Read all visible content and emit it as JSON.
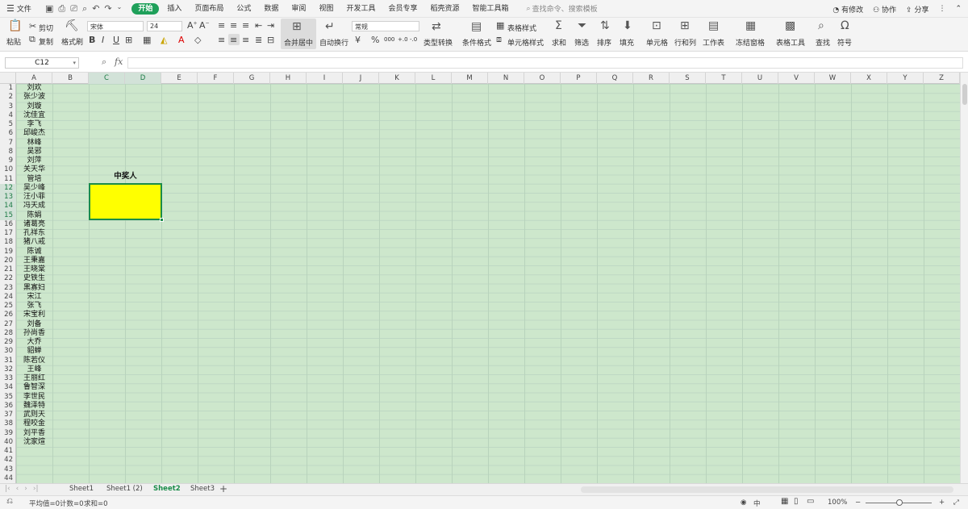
{
  "menubar": {
    "file_label": "文件",
    "tabs": [
      "开始",
      "插入",
      "页面布局",
      "公式",
      "数据",
      "审阅",
      "视图",
      "开发工具",
      "会员专享",
      "稻壳资源",
      "智能工具箱"
    ],
    "active_tab": "开始",
    "search_placeholder": "查找命令、搜索模板",
    "changes_label": "有修改",
    "collab_label": "协作",
    "share_label": "分享"
  },
  "ribbon": {
    "paste": "粘贴",
    "cut": "剪切",
    "copy": "复制",
    "format_painter": "格式刷",
    "font_name": "宋体",
    "font_size": "24",
    "merge_center": "合并居中",
    "wrap_text": "自动换行",
    "number_format": "常规",
    "type_convert": "类型转换",
    "cond_format": "条件格式",
    "table_style": "表格样式",
    "cell_style": "单元格样式",
    "sum": "求和",
    "filter": "筛选",
    "sort": "排序",
    "fill": "填充",
    "cell": "单元格",
    "row_col": "行和列",
    "worksheet": "工作表",
    "freeze": "冻结窗格",
    "table_tools": "表格工具",
    "find": "查找",
    "symbol": "符号"
  },
  "formula_bar": {
    "name_box": "C12",
    "fx": "fx",
    "content": ""
  },
  "columns": [
    "A",
    "B",
    "C",
    "D",
    "E",
    "F",
    "G",
    "H",
    "I",
    "J",
    "K",
    "L",
    "M",
    "N",
    "O",
    "P",
    "Q",
    "R",
    "S",
    "T",
    "U",
    "V",
    "W",
    "X",
    "Y",
    "Z"
  ],
  "selected_columns": [
    "C",
    "D"
  ],
  "rows": [
    "1",
    "2",
    "3",
    "4",
    "5",
    "6",
    "7",
    "8",
    "9",
    "10",
    "11",
    "12",
    "13",
    "14",
    "15",
    "16",
    "17",
    "18",
    "19",
    "20",
    "21",
    "22",
    "23",
    "24",
    "25",
    "26",
    "27",
    "28",
    "29",
    "30",
    "31",
    "32",
    "33",
    "34",
    "35",
    "36",
    "37",
    "38",
    "39",
    "40",
    "41",
    "42",
    "43",
    "44"
  ],
  "selected_rows": [
    "12",
    "13",
    "14",
    "15"
  ],
  "names": [
    "刘欢",
    "张少波",
    "刘璇",
    "沈佳宜",
    "李飞",
    "邱峻杰",
    "林峰",
    "吴邪",
    "刘萍",
    "关天华",
    "管培",
    "吴少峰",
    "汪小菲",
    "冯天成",
    "陈娟",
    "诸葛亮",
    "孔祥东",
    "猪八戒",
    "陈诚",
    "王秉嘉",
    "王晓棠",
    "史铁生",
    "黑寡妇",
    "宋江",
    "张飞",
    "宋宝利",
    "刘备",
    "孙尚香",
    "大乔",
    "貂蝉",
    "陈若仪",
    "王峰",
    "王丽红",
    "鲁智深",
    "李世民",
    "魏泽特",
    "武则天",
    "程咬金",
    "刘平香",
    "沈家煊"
  ],
  "winner_title": "中奖人",
  "sheets": [
    "Sheet1",
    "Sheet1 (2)",
    "Sheet2",
    "Sheet3"
  ],
  "active_sheet": "Sheet2",
  "status": {
    "average": "平均值=0",
    "count": "计数=0",
    "sum": "求和=0",
    "lang": "中",
    "zoom": "100%"
  },
  "colors": {
    "accent": "#1fa05a",
    "grid_bg": "#cde7cc",
    "highlight": "#ffff00"
  }
}
